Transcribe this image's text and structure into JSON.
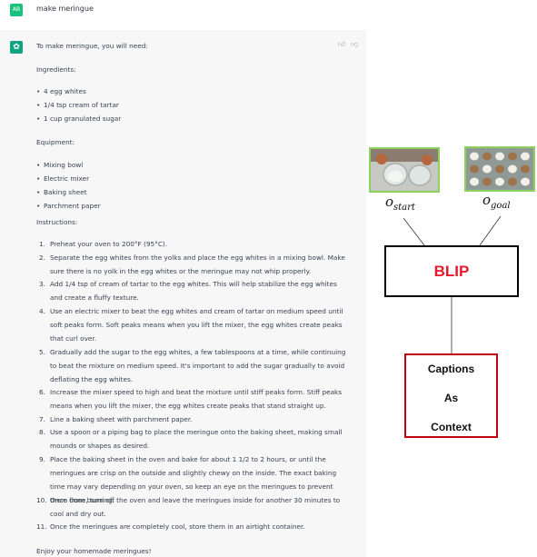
{
  "user_message": {
    "avatar": "AB",
    "text": "make meringue"
  },
  "assistant": {
    "intro": "To make meringue, you will need:",
    "ingredients_heading": "Ingredients:",
    "ingredients": [
      "4 egg whites",
      "1/4 tsp cream of tartar",
      "1 cup granulated sugar"
    ],
    "equipment_heading": "Equipment:",
    "equipment": [
      "Mixing bowl",
      "Electric mixer",
      "Baking sheet",
      "Parchment paper"
    ],
    "instructions_heading": "Instructions:",
    "instructions": [
      [
        "Preheat your oven to 200°F (95°C)."
      ],
      [
        "Separate the egg whites from the yolks and place the egg whites in a mixing bowl. Make",
        "sure there is no yolk in the egg whites or the meringue may not whip properly."
      ],
      [
        "Add 1/4 tsp of cream of tartar to the egg whites. This will help stabilize the egg whites",
        "and create a fluffy texture."
      ],
      [
        "Use an electric mixer to beat the egg whites and cream of tartar on medium speed until",
        "soft peaks form. Soft peaks means when you lift the mixer, the egg whites create peaks",
        "that curl over."
      ],
      [
        "Gradually add the sugar to the egg whites, a few tablespoons at a time, while continuing",
        "to beat the mixture on medium speed. It's important to add the sugar gradually to avoid",
        "deflating the egg whites."
      ],
      [
        "Increase the mixer speed to high and beat the mixture until stiff peaks form. Stiff peaks",
        "means when you lift the mixer, the egg whites create peaks that stand straight up."
      ],
      [
        "Line a baking sheet with parchment paper."
      ],
      [
        "Use a spoon or a piping bag to place the meringue onto the baking sheet, making small",
        "mounds or shapes as desired."
      ],
      [
        "Place the baking sheet in the oven and bake for about 1 1/2 to 2 hours, or until the",
        "meringues are crisp on the outside and slightly chewy on the inside. The exact baking",
        "time may vary depending on your oven, so keep an eye on the meringues to prevent",
        "them from burning."
      ],
      [
        "Once done, turn off the oven and leave the meringues inside for another 30 minutes to",
        "cool and dry out."
      ],
      [
        "Once the meringues are completely cool, store them in an airtight container."
      ]
    ],
    "closing": "Enjoy your homemade meringues!"
  },
  "diagram": {
    "start_label": {
      "base": "o",
      "sub": "start"
    },
    "goal_label": {
      "base": "o",
      "sub": "goal"
    },
    "model_label": "BLIP",
    "output_lines": [
      "Captions",
      "As",
      "Context"
    ],
    "colors": {
      "photo_border": "#8bd35a",
      "blip_text": "#e8192c",
      "captions_border": "#c0000e"
    }
  }
}
